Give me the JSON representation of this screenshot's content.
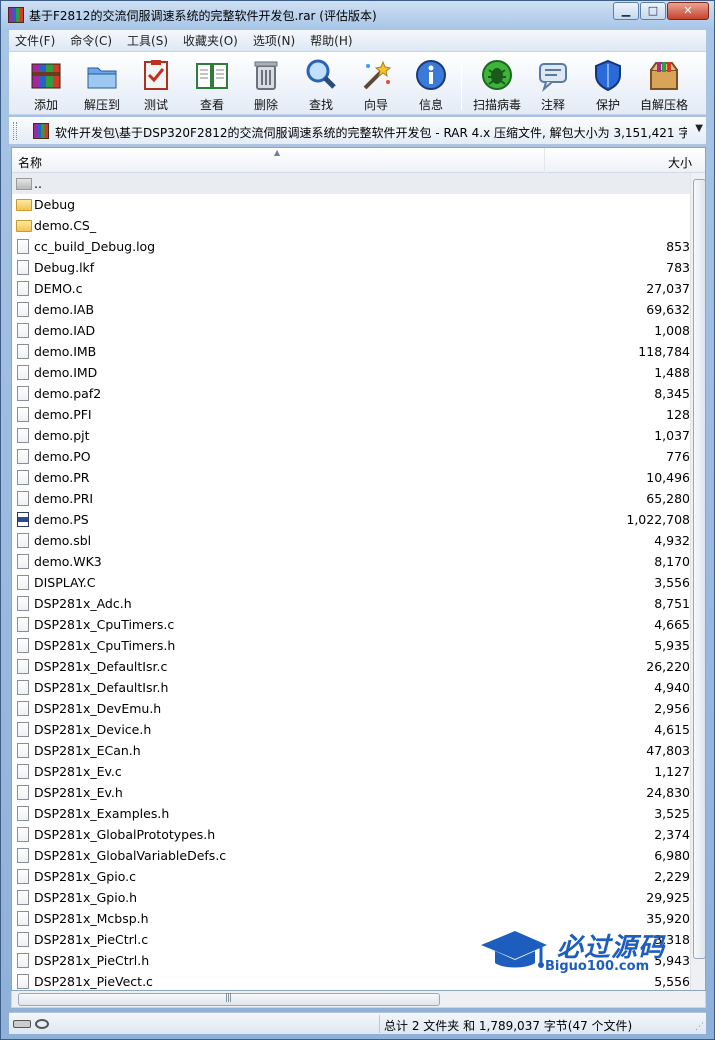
{
  "window": {
    "title": "基于F2812的交流伺服调速系统的完整软件开发包.rar (评估版本)",
    "min_glyph": "▁",
    "max_glyph": "□",
    "close_glyph": "✕"
  },
  "menu": [
    "文件(F)",
    "命令(C)",
    "工具(S)",
    "收藏夹(O)",
    "选项(N)",
    "帮助(H)"
  ],
  "toolbar": [
    {
      "label": "添加",
      "icon": "add-archive-icon"
    },
    {
      "label": "解压到",
      "icon": "extract-to-icon"
    },
    {
      "label": "测试",
      "icon": "test-icon"
    },
    {
      "label": "查看",
      "icon": "view-book-icon"
    },
    {
      "label": "删除",
      "icon": "trash-icon"
    },
    {
      "label": "查找",
      "icon": "magnifier-icon"
    },
    {
      "label": "向导",
      "icon": "wizard-icon"
    },
    {
      "label": "信息",
      "icon": "info-icon"
    },
    {
      "label": "扫描病毒",
      "icon": "virus-scan-icon"
    },
    {
      "label": "注释",
      "icon": "comment-icon"
    },
    {
      "label": "保护",
      "icon": "shield-icon"
    },
    {
      "label": "自解压格",
      "icon": "sfx-box-icon"
    }
  ],
  "address": {
    "path": "软件开发包\\基于DSP320F2812的交流伺服调速系统的完整软件开发包 - RAR 4.x 压缩文件, 解包大小为 3,151,421 字节",
    "dropdown_glyph": "▼"
  },
  "columns": {
    "name": "名称",
    "size": "大小",
    "sort_glyph": "▲"
  },
  "files": [
    {
      "name": "..",
      "size": "",
      "type": "up"
    },
    {
      "name": "Debug",
      "size": "",
      "type": "folder"
    },
    {
      "name": "demo.CS_",
      "size": "",
      "type": "folder"
    },
    {
      "name": "cc_build_Debug.log",
      "size": "853",
      "type": "file"
    },
    {
      "name": "Debug.lkf",
      "size": "783",
      "type": "file"
    },
    {
      "name": "DEMO.c",
      "size": "27,037",
      "type": "file"
    },
    {
      "name": "demo.IAB",
      "size": "69,632",
      "type": "file"
    },
    {
      "name": "demo.IAD",
      "size": "1,008",
      "type": "file"
    },
    {
      "name": "demo.IMB",
      "size": "118,784",
      "type": "file"
    },
    {
      "name": "demo.IMD",
      "size": "1,488",
      "type": "file"
    },
    {
      "name": "demo.paf2",
      "size": "8,345",
      "type": "file"
    },
    {
      "name": "demo.PFI",
      "size": "128",
      "type": "file"
    },
    {
      "name": "demo.pjt",
      "size": "1,037",
      "type": "file"
    },
    {
      "name": "demo.PO",
      "size": "776",
      "type": "file"
    },
    {
      "name": "demo.PR",
      "size": "10,496",
      "type": "file"
    },
    {
      "name": "demo.PRI",
      "size": "65,280",
      "type": "file"
    },
    {
      "name": "demo.PS",
      "size": "1,022,708",
      "type": "special"
    },
    {
      "name": "demo.sbl",
      "size": "4,932",
      "type": "file"
    },
    {
      "name": "demo.WK3",
      "size": "8,170",
      "type": "file"
    },
    {
      "name": "DISPLAY.C",
      "size": "3,556",
      "type": "file"
    },
    {
      "name": "DSP281x_Adc.h",
      "size": "8,751",
      "type": "file"
    },
    {
      "name": "DSP281x_CpuTimers.c",
      "size": "4,665",
      "type": "file"
    },
    {
      "name": "DSP281x_CpuTimers.h",
      "size": "5,935",
      "type": "file"
    },
    {
      "name": "DSP281x_DefaultIsr.c",
      "size": "26,220",
      "type": "file"
    },
    {
      "name": "DSP281x_DefaultIsr.h",
      "size": "4,940",
      "type": "file"
    },
    {
      "name": "DSP281x_DevEmu.h",
      "size": "2,956",
      "type": "file"
    },
    {
      "name": "DSP281x_Device.h",
      "size": "4,615",
      "type": "file"
    },
    {
      "name": "DSP281x_ECan.h",
      "size": "47,803",
      "type": "file"
    },
    {
      "name": "DSP281x_Ev.c",
      "size": "1,127",
      "type": "file"
    },
    {
      "name": "DSP281x_Ev.h",
      "size": "24,830",
      "type": "file"
    },
    {
      "name": "DSP281x_Examples.h",
      "size": "3,525",
      "type": "file"
    },
    {
      "name": "DSP281x_GlobalPrototypes.h",
      "size": "2,374",
      "type": "file"
    },
    {
      "name": "DSP281x_GlobalVariableDefs.c",
      "size": "6,980",
      "type": "file"
    },
    {
      "name": "DSP281x_Gpio.c",
      "size": "2,229",
      "type": "file"
    },
    {
      "name": "DSP281x_Gpio.h",
      "size": "29,925",
      "type": "file"
    },
    {
      "name": "DSP281x_Mcbsp.h",
      "size": "35,920",
      "type": "file"
    },
    {
      "name": "DSP281x_PieCtrl.c",
      "size": "3,318",
      "type": "file"
    },
    {
      "name": "DSP281x_PieCtrl.h",
      "size": "5,943",
      "type": "file"
    },
    {
      "name": "DSP281x_PieVect.c",
      "size": "5,556",
      "type": "file"
    }
  ],
  "status": {
    "summary": "总计 2 文件夹 和 1,789,037 字节(47 个文件)"
  },
  "watermark": {
    "main": "必过源码",
    "sub": "Biguo100.com"
  },
  "colors": {
    "accent": "#1c5dbe",
    "selection": "#e9edf2"
  }
}
